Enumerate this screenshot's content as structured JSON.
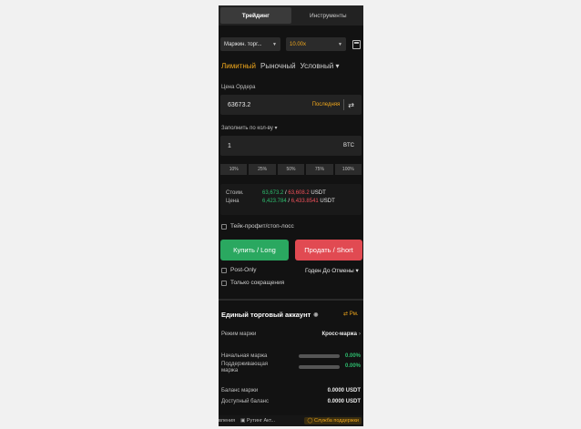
{
  "tabs": [
    "Трейдинг",
    "Инструменты"
  ],
  "margin_mode": "Маржин. торг...",
  "leverage": "10.00x",
  "order_types": {
    "limit": "Лимитный",
    "market": "Рыночный",
    "conditional": "Условный"
  },
  "price": {
    "label": "Цена Ордера",
    "value": "63673.2",
    "last_label": "Последняя"
  },
  "qty": {
    "label": "Заполнить по кол-ву",
    "value": "1",
    "unit": "BTC"
  },
  "percentages": [
    "10%",
    "25%",
    "50%",
    "75%",
    "100%"
  ],
  "cost": {
    "label": "Стоим.",
    "buy": "63,673.2",
    "slash": "/",
    "sell": "63,608.2",
    "unit": "USDT",
    "price_label": "Цена",
    "buy_price": "6,423.784",
    "sell_price": "6,433.8541",
    "price_unit": "USDT"
  },
  "tpsl": "Тейк-профит/стоп-лосс",
  "buttons": {
    "buy": "Купить / Long",
    "sell": "Продать / Short"
  },
  "post_only": "Post-Only",
  "tif": "Годен До Отмены",
  "reduce_only": "Только сокращения",
  "account": {
    "title": "Единый торговый аккаунт",
    "link": "Рм.",
    "margin_mode_label": "Режим маржи",
    "margin_mode_value": "Кросс-маржа",
    "initial_margin": "Начальная маржа",
    "initial_margin_value": "0.00%",
    "maint_margin": "Поддерживающая маржа",
    "maint_margin_value": "0.00%",
    "margin_balance": "Баланс маржи",
    "margin_balance_value": "0.0000 USDT",
    "available_balance": "Доступный баланс",
    "available_balance_value": "0.0000 USDT"
  },
  "footer": {
    "left": "вления",
    "rating": "Рутинг Акт...",
    "support": "Служба поддержки"
  },
  "colors": {
    "accent": "#f0a71c",
    "buy": "#2aa860",
    "sell": "#e14a52"
  }
}
